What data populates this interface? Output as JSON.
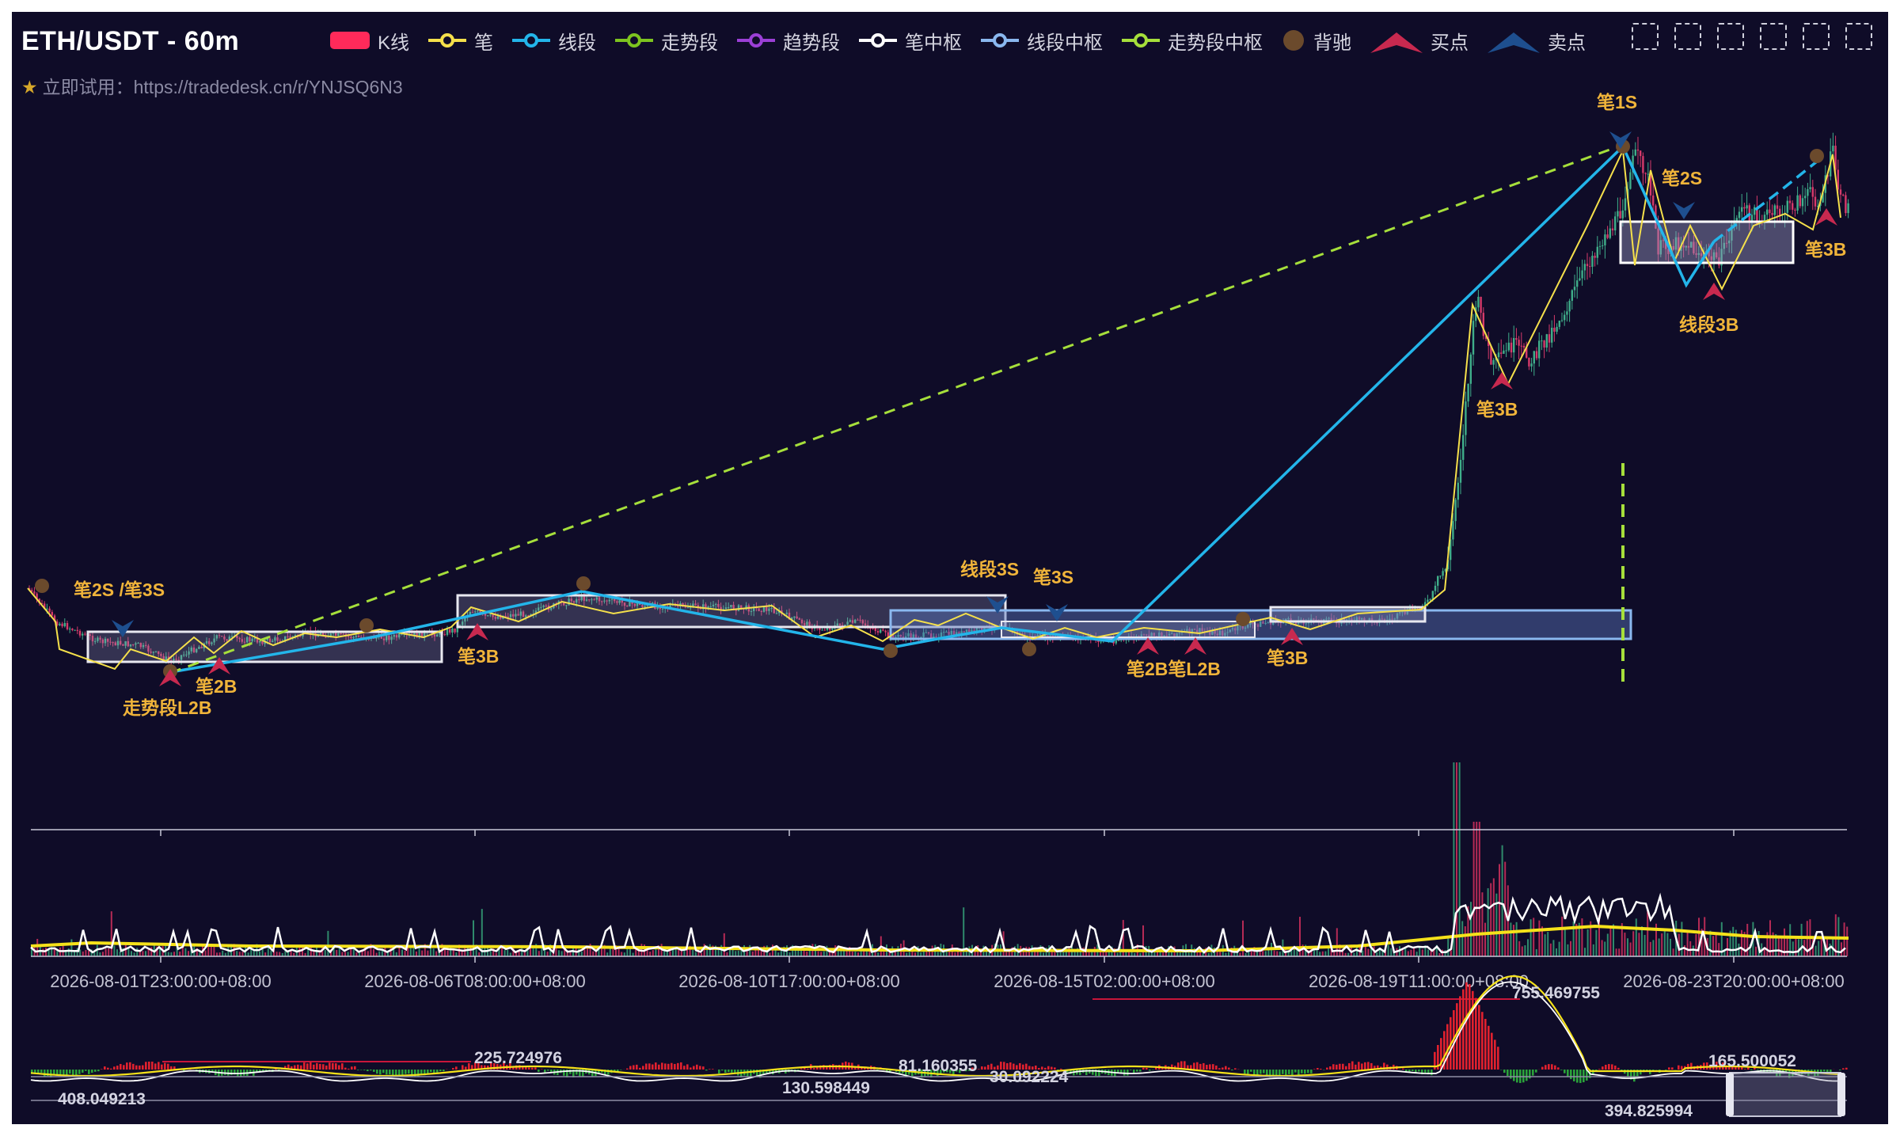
{
  "title": "ETH/USDT - 60m",
  "trial_text": "立即试用：https://tradedesk.cn/r/YNJSQ6N3",
  "legend": [
    {
      "label": "K线",
      "icon": "candle-rect-icon",
      "color": "#ff2a5a"
    },
    {
      "label": "笔",
      "icon": "line-dot-icon",
      "color": "#f5e04b"
    },
    {
      "label": "线段",
      "icon": "line-dot-icon",
      "color": "#23b5ea"
    },
    {
      "label": "走势段",
      "icon": "line-dot-icon",
      "color": "#7dc41f"
    },
    {
      "label": "趋势段",
      "icon": "line-dot-icon",
      "color": "#9b3fd6"
    },
    {
      "label": "笔中枢",
      "icon": "line-dot-icon",
      "color": "#ffffff"
    },
    {
      "label": "线段中枢",
      "icon": "line-dot-icon",
      "color": "#8ab8ef"
    },
    {
      "label": "走势段中枢",
      "icon": "line-dot-icon",
      "color": "#a6df3b"
    },
    {
      "label": "背驰",
      "icon": "dot-icon",
      "color": "#6b4a2c"
    },
    {
      "label": "买点",
      "icon": "up-arrow-icon",
      "color": "#c8294f"
    },
    {
      "label": "卖点",
      "icon": "down-arrow-icon",
      "color": "#1e4f8f"
    }
  ],
  "toolbox": [
    "rect-zoom-icon",
    "lasso-select-icon",
    "pan-icon",
    "fullscreen-icon",
    "data-view-icon",
    "clear-icon"
  ],
  "chart_data": {
    "type": "line",
    "x_ticks": [
      "2026-08-01T23:00:00+08:00",
      "2026-08-06T08:00:00+08:00",
      "2026-08-10T17:00:00+08:00",
      "2026-08-15T02:00:00+08:00",
      "2026-08-19T11:00:00+08:00",
      "2026-08-23T20:00:00+08:00"
    ],
    "annotations": [
      {
        "label": "笔2S /笔3S",
        "kind": "sell"
      },
      {
        "label": "笔2B",
        "kind": "buy"
      },
      {
        "label": "走势段L2B",
        "kind": "buy"
      },
      {
        "label": "笔3B",
        "kind": "buy"
      },
      {
        "label": "线段3S",
        "kind": "sell"
      },
      {
        "label": "笔3S",
        "kind": "sell"
      },
      {
        "label": "笔2B笔L2B",
        "kind": "buy"
      },
      {
        "label": "笔3B",
        "kind": "buy"
      },
      {
        "label": "笔3B",
        "kind": "buy"
      },
      {
        "label": "笔1S",
        "kind": "sell"
      },
      {
        "label": "笔2S",
        "kind": "sell"
      },
      {
        "label": "线段3B",
        "kind": "buy"
      },
      {
        "label": "笔3B",
        "kind": "buy"
      }
    ],
    "macd_labels": [
      "225.724976",
      "81.160355",
      "30.092224",
      "130.598449",
      "408.049213",
      "755.469755",
      "165.500052",
      "394.825994"
    ],
    "series": [
      {
        "name": "笔",
        "color": "#f5e04b"
      },
      {
        "name": "线段",
        "color": "#23b5ea"
      },
      {
        "name": "走势段",
        "color": "#a6df3b"
      }
    ]
  }
}
